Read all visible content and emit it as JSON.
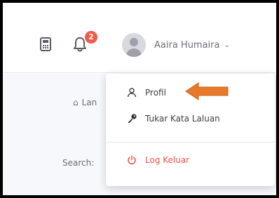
{
  "header": {
    "notification_count": "2",
    "user_name": "Aaira Humaira",
    "caret": "⌄"
  },
  "page": {
    "home_tab_partial": "Lan",
    "search_label_partial": "Search:"
  },
  "dropdown": {
    "items": [
      {
        "label": "Profil",
        "icon": "user-icon"
      },
      {
        "label": "Tukar Kata Laluan",
        "icon": "key-icon"
      },
      {
        "label": "Log Keluar",
        "icon": "power-icon"
      }
    ]
  },
  "colors": {
    "badge": "#f25a4a",
    "logout": "#f2524c",
    "arrow": "#e8782a",
    "frame_border": "#000000"
  }
}
